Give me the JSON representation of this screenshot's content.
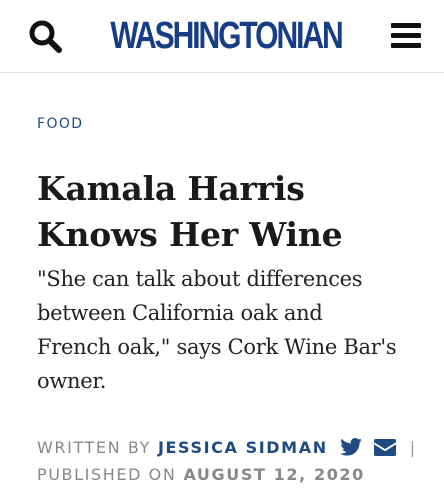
{
  "header": {
    "logo_text": "WASHINGTONIAN",
    "search_icon": "search-icon",
    "menu_icon": "hamburger-menu-icon"
  },
  "article": {
    "category": "FOOD",
    "headline_line1": "Kamala Harris",
    "headline_line2": "Knows Her Wine",
    "dek_line1": "\"She can talk about differences",
    "dek_line2": "between California oak and",
    "dek_line3": "French oak,\" says Cork Wine Bar's",
    "dek_line4": "owner.",
    "byline": {
      "written_by_label": "WRITTEN BY",
      "author": "JESSICA SIDMAN",
      "separator": "|",
      "published_on_label": "PUBLISHED ON",
      "date": "AUGUST 12, 2020",
      "twitter_icon": "twitter-icon",
      "email_icon": "email-icon"
    }
  },
  "colors": {
    "brand_blue": "#163d86",
    "link_blue": "#1f4b82",
    "meta_gray": "#888888",
    "text_dark": "#1a1a1a"
  }
}
